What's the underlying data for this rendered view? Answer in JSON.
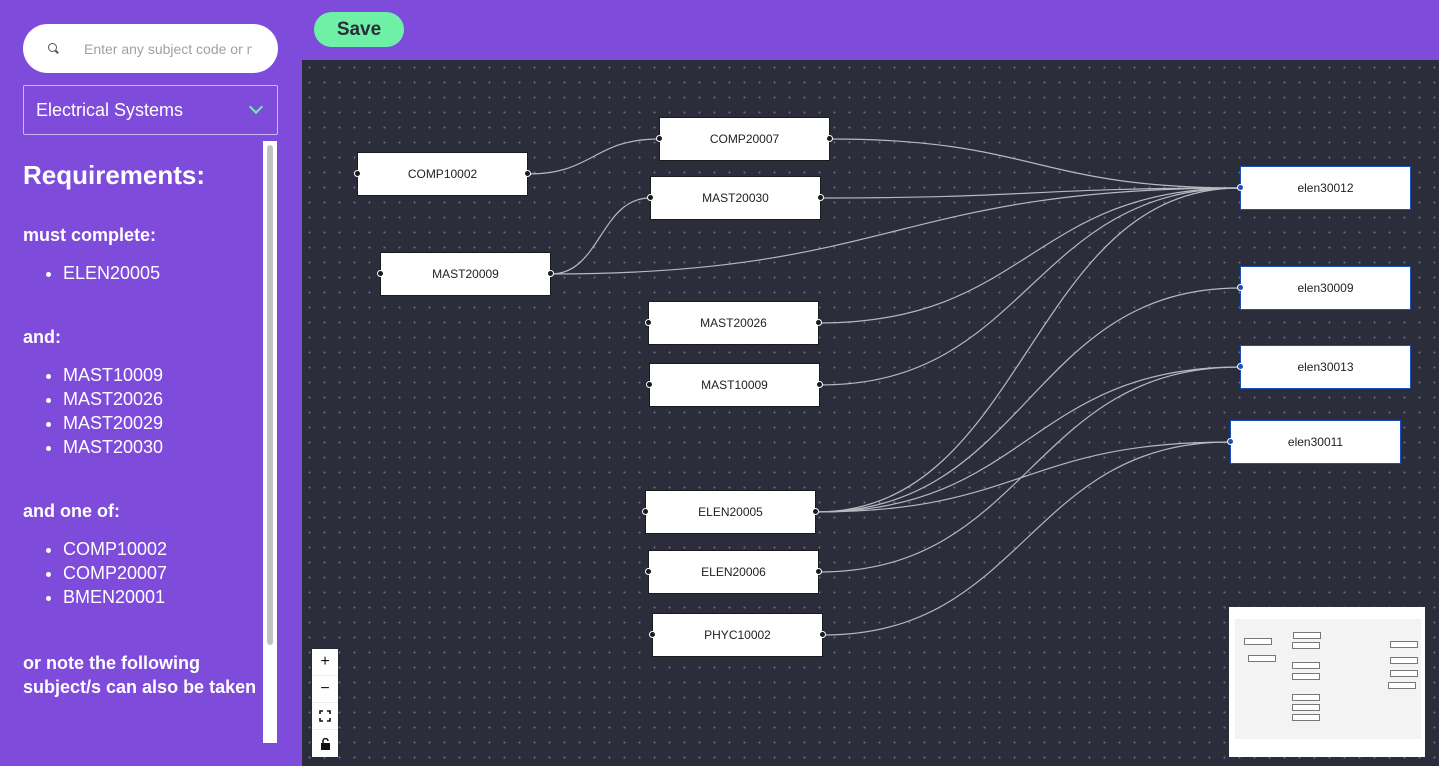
{
  "toolbar": {
    "save_label": "Save"
  },
  "search": {
    "placeholder": "Enter any subject code or name"
  },
  "course_select": {
    "value": "Electrical Systems"
  },
  "requirements": {
    "title": "Requirements:",
    "groups": [
      {
        "heading": "must complete:",
        "items": [
          "ELEN20005"
        ]
      },
      {
        "heading": "and:",
        "items": [
          "MAST10009",
          "MAST20026",
          "MAST20029",
          "MAST20030"
        ]
      },
      {
        "heading": "and one of:",
        "items": [
          "COMP10002",
          "COMP20007",
          "BMEN20001"
        ]
      },
      {
        "heading": "or note the following subject/s can also be taken",
        "items": []
      }
    ]
  },
  "graph": {
    "nodes": [
      {
        "id": "COMP10002",
        "label": "COMP10002"
      },
      {
        "id": "COMP20007",
        "label": "COMP20007"
      },
      {
        "id": "MAST20030",
        "label": "MAST20030"
      },
      {
        "id": "MAST20009",
        "label": "MAST20009"
      },
      {
        "id": "MAST20026",
        "label": "MAST20026"
      },
      {
        "id": "MAST10009",
        "label": "MAST10009"
      },
      {
        "id": "ELEN20005",
        "label": "ELEN20005"
      },
      {
        "id": "ELEN20006",
        "label": "ELEN20006"
      },
      {
        "id": "PHYC10002",
        "label": "PHYC10002"
      },
      {
        "id": "elen30012",
        "label": "elen30012"
      },
      {
        "id": "elen30009",
        "label": "elen30009"
      },
      {
        "id": "elen30013",
        "label": "elen30013"
      },
      {
        "id": "elen30011",
        "label": "elen30011"
      }
    ],
    "edges": [
      {
        "from": "COMP10002",
        "to": "COMP20007"
      },
      {
        "from": "MAST20009",
        "to": "MAST20030"
      },
      {
        "from": "COMP20007",
        "to": "elen30012"
      },
      {
        "from": "MAST20030",
        "to": "elen30012"
      },
      {
        "from": "MAST20009",
        "to": "elen30012"
      },
      {
        "from": "MAST20026",
        "to": "elen30012"
      },
      {
        "from": "MAST10009",
        "to": "elen30012"
      },
      {
        "from": "ELEN20005",
        "to": "elen30012"
      },
      {
        "from": "ELEN20005",
        "to": "elen30009"
      },
      {
        "from": "ELEN20005",
        "to": "elen30013"
      },
      {
        "from": "ELEN20005",
        "to": "elen30011"
      },
      {
        "from": "ELEN20006",
        "to": "elen30013"
      },
      {
        "from": "PHYC10002",
        "to": "elen30011"
      }
    ],
    "colors": {
      "edge": "#b8b8c0",
      "handle": "#1a1a1a",
      "target_handle": "#1a4fbf"
    }
  },
  "controls": [
    "zoom-in",
    "zoom-out",
    "fit-view",
    "lock"
  ],
  "theme": {
    "accent": "#7e4bdb",
    "save": "#6ef0a6",
    "canvas": "#2b2d3a"
  }
}
